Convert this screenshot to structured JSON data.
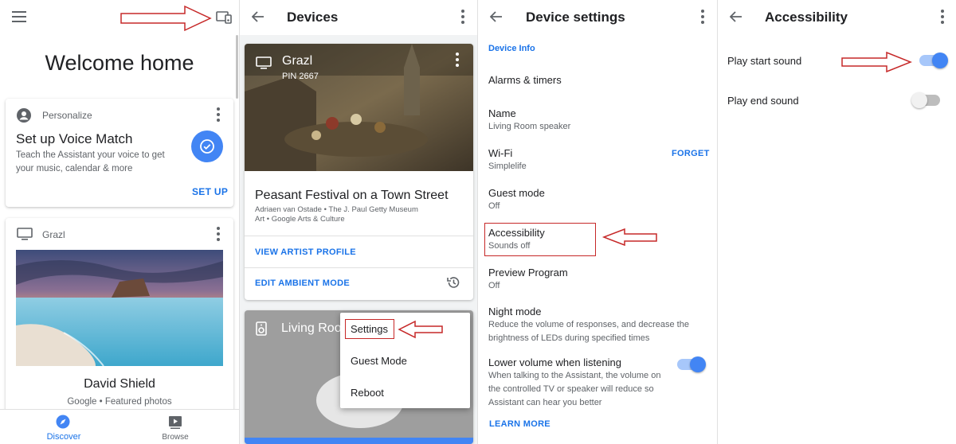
{
  "colors": {
    "accent": "#1a73e8",
    "annotation": "#c62828",
    "fab": "#4285f4"
  },
  "screen1": {
    "voice_match_card": {
      "category": "Personalize",
      "title": "Set up Voice Match",
      "desc_line1": "Teach the Assistant your voice to get",
      "desc_line2": "your music, calendar & more",
      "action": "SET UP"
    },
    "welcome": "Welcome home",
    "device_card": {
      "device_name": "Grazl",
      "photo_title": "David Shield",
      "photo_sub": "Google • Featured photos"
    },
    "bottom_nav": [
      {
        "label": "Discover",
        "icon": "compass-icon"
      },
      {
        "label": "Browse",
        "icon": "play-library-icon"
      }
    ]
  },
  "screen2": {
    "title": "Devices",
    "artwork_card": {
      "device_name": "Grazl",
      "pin": "PIN 2667",
      "art_title": "Peasant Festival on a Town Street",
      "art_meta1": "Adriaen van Ostade • The J. Paul Getty Museum",
      "art_meta2": "Art • Google Arts & Culture",
      "action1": "VIEW ARTIST PROFILE",
      "action2": "EDIT AMBIENT MODE"
    },
    "speaker_card": {
      "name": "Living Room speaker"
    },
    "menu": {
      "items": [
        "Settings",
        "Guest Mode",
        "Reboot"
      ]
    }
  },
  "screen3": {
    "title": "Device settings",
    "section": "Device Info",
    "rows": [
      {
        "title": "Alarms & timers",
        "sub": ""
      },
      {
        "title": "Name",
        "sub": "Living Room speaker"
      },
      {
        "title": "Wi-Fi",
        "sub": "Simplelife",
        "action": "FORGET"
      },
      {
        "title": "Guest mode",
        "sub": "Off"
      },
      {
        "title": "Accessibility",
        "sub": "Sounds off"
      },
      {
        "title": "Preview Program",
        "sub": "Off"
      },
      {
        "title": "Night mode",
        "sub1": "Reduce the volume of responses, and decrease the",
        "sub2": "brightness of LEDs during specified times"
      },
      {
        "title": "Lower volume when listening",
        "sub1": "When talking to the Assistant, the volume on",
        "sub2": "the controlled TV or speaker will reduce so",
        "sub3": "Assistant can hear you better",
        "toggle": true
      }
    ],
    "learn_more": "LEARN MORE"
  },
  "screen4": {
    "title": "Accessibility",
    "settings": [
      {
        "label": "Play start sound",
        "on": true
      },
      {
        "label": "Play end sound",
        "on": false
      }
    ]
  }
}
